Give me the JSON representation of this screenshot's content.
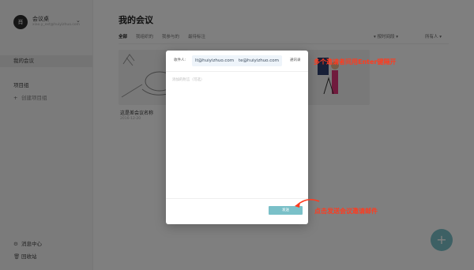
{
  "sidebar": {
    "avatar_letter": "肖",
    "app_name": "会议桌",
    "user_email": "xiao.y_ext@huiyizhuo.com",
    "items": [
      {
        "label": "我的会议",
        "icon": ""
      },
      {
        "label": "项目组",
        "icon": ""
      },
      {
        "label": "创建项目组",
        "icon": "plus-icon"
      }
    ],
    "bottom": [
      {
        "label": "消息中心",
        "icon": "gear-icon"
      },
      {
        "label": "回收站",
        "icon": "trash-icon"
      }
    ]
  },
  "main": {
    "title": "我的会议",
    "filters": [
      "全部",
      "我组织的",
      "我参与的",
      "最待标注"
    ],
    "sort": "按时间段",
    "sort2": "所有人",
    "card": {
      "name": "这是差会议名称",
      "date": "2016-12-20"
    }
  },
  "modal": {
    "to_label": "收件人:",
    "recipients": [
      "lt@huiyizhuo.com",
      "te@huiyizhuo.com"
    ],
    "contacts_label": "通讯录",
    "message_placeholder": "添加的附言（可选）",
    "send_label": "发送"
  },
  "annotations": {
    "top_note": "多个邀请者间用Enter键隔开",
    "bottom_note": "点击发送会议邀请邮件",
    "color": "#ff3b1f"
  },
  "colors": {
    "accent": "#7ac0c8"
  }
}
